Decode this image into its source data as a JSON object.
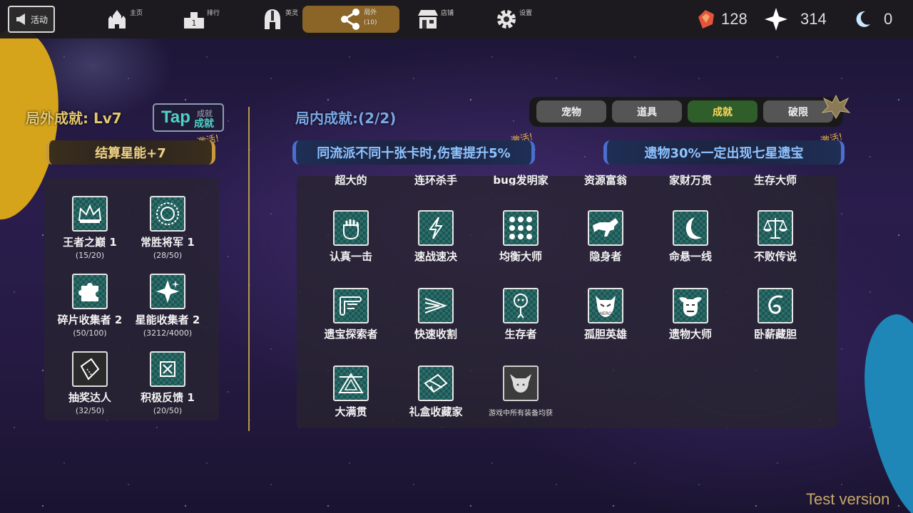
{
  "topbar": {
    "activity_label": "活动",
    "nav": [
      {
        "label": "主页",
        "icon": "castle-icon"
      },
      {
        "label": "排行",
        "icon": "podium-icon"
      },
      {
        "label": "英灵",
        "icon": "helmet-icon"
      },
      {
        "label": "局外",
        "sublabel": "(10)",
        "icon": "share-icon",
        "active": true
      },
      {
        "label": "店铺",
        "icon": "shop-icon"
      },
      {
        "label": "设置",
        "icon": "gear-icon"
      }
    ],
    "resources": [
      {
        "icon": "gem-icon",
        "value": "128"
      },
      {
        "icon": "star-sparkle-icon",
        "value": "314"
      },
      {
        "icon": "moon-icon",
        "value": "0"
      }
    ]
  },
  "left": {
    "title": "局外成就: Lv7",
    "tap_badge": {
      "big": "Tap",
      "top": "成就",
      "bottom": "成就"
    },
    "activated_tag": "激活!",
    "bonus": "结算星能+7",
    "achievements": [
      {
        "name": "王者之巅 1",
        "progress": "(15/20)",
        "icon": "crown-icon"
      },
      {
        "name": "常胜将军 1",
        "progress": "(28/50)",
        "icon": "wreath-icon"
      },
      {
        "name": "碎片收集者 2",
        "progress": "(50/100)",
        "icon": "puzzle-icon"
      },
      {
        "name": "星能收集者 2",
        "progress": "(3212/4000)",
        "icon": "sparkle-icon"
      },
      {
        "name": "抽奖达人",
        "progress": "(32/50)",
        "icon": "ticket-icon"
      },
      {
        "name": "积极反馈 1",
        "progress": "(20/50)",
        "icon": "feedback-icon"
      }
    ]
  },
  "right": {
    "title": "局内成就:(2/2)",
    "tabs": [
      {
        "label": "宠物",
        "active": false
      },
      {
        "label": "道具",
        "active": false
      },
      {
        "label": "成就",
        "active": true
      },
      {
        "label": "破限",
        "active": false
      }
    ],
    "activated_tag_1": "激活!",
    "activated_tag_2": "激活!",
    "bonus_1": "同流派不同十张卡时,伤害提升5%",
    "bonus_2": "遗物30%一定出现七星遗宝",
    "cut_row": [
      "超大的",
      "连环杀手",
      "bug发明家",
      "资源富翁",
      "家财万贯",
      "生存大师"
    ],
    "achievements": [
      {
        "name": "认真一击",
        "icon": "fist-icon"
      },
      {
        "name": "速战速决",
        "icon": "lightning-icon"
      },
      {
        "name": "均衡大师",
        "icon": "dots-grid-icon"
      },
      {
        "name": "隐身者",
        "icon": "wolf-icon"
      },
      {
        "name": "命悬一线",
        "icon": "crescent-icon"
      },
      {
        "name": "不败传说",
        "icon": "scales-icon"
      },
      {
        "name": "遗宝探索者",
        "icon": "scroll-icon"
      },
      {
        "name": "快速收割",
        "icon": "arrows-icon"
      },
      {
        "name": "生存者",
        "icon": "stick-figure-icon"
      },
      {
        "name": "孤胆英雄",
        "icon": "hero-mask-icon"
      },
      {
        "name": "遗物大师",
        "icon": "demon-face-icon"
      },
      {
        "name": "卧薪藏胆",
        "icon": "swirl-icon"
      },
      {
        "name": "大满贯",
        "icon": "triangle-icon"
      },
      {
        "name": "礼盒收藏家",
        "icon": "gift-box-icon"
      },
      {
        "name": "",
        "desc": "游戏中所有装备均获",
        "icon": "horned-skull-icon",
        "locked": true
      }
    ]
  },
  "footer": {
    "test_version": "Test version"
  }
}
